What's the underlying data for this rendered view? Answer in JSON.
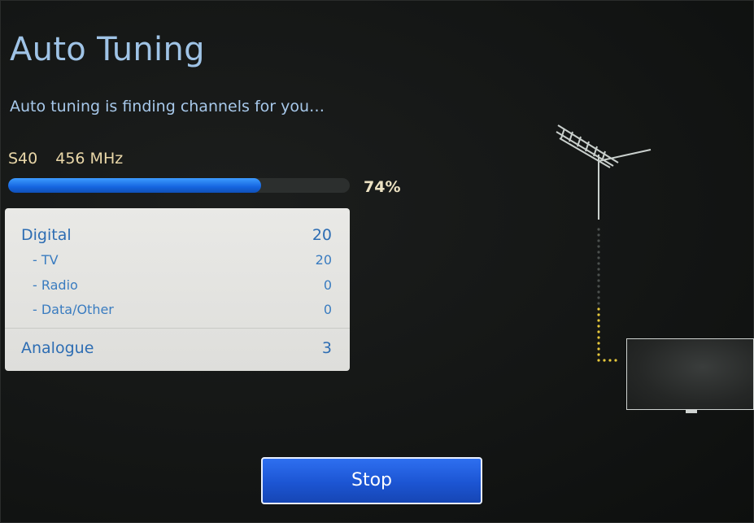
{
  "screen": {
    "title": "Auto Tuning",
    "subtitle": "Auto tuning is finding channels for you…"
  },
  "current_channel": {
    "id": "S40",
    "frequency": "456 MHz"
  },
  "progress": {
    "percent": 74,
    "percent_label": "74%"
  },
  "results": {
    "digital": {
      "label": "Digital",
      "value": "20"
    },
    "tv": {
      "label": "- TV",
      "value": "20"
    },
    "radio": {
      "label": "- Radio",
      "value": "0"
    },
    "data_other": {
      "label": "- Data/Other",
      "value": "0"
    },
    "analogue": {
      "label": "Analogue",
      "value": "3"
    }
  },
  "actions": {
    "stop_label": "Stop"
  },
  "icons": {
    "antenna": "antenna-icon",
    "tv": "tv-icon"
  },
  "colors": {
    "title_blue": "#9fc3e6",
    "progress_blue": "#1e74f0",
    "panel_text_blue": "#2d6db3",
    "signal_yellow": "#e6c83c"
  }
}
